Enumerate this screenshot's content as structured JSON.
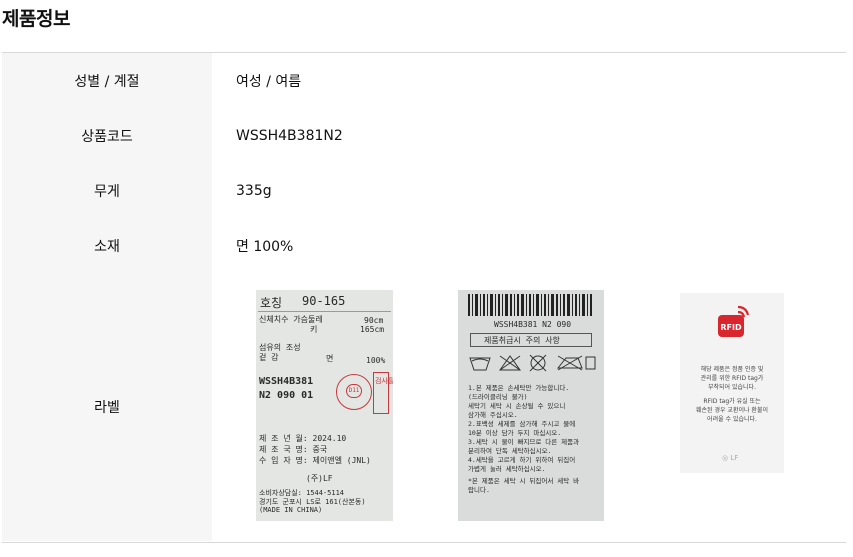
{
  "section": {
    "title": "제품정보"
  },
  "rows": [
    {
      "label": "성별 / 계절",
      "value": "여성 / 여름"
    },
    {
      "label": "상품코드",
      "value": "WSSH4B381N2"
    },
    {
      "label": "무게",
      "value": "335g"
    },
    {
      "label": "소재",
      "value": "면 100%"
    },
    {
      "label": "라벨"
    }
  ],
  "label_front": {
    "size_title": "호칭",
    "size_value": "90-165",
    "body_label": "신체치수 가슴둘레",
    "chest": "90cm",
    "height_label": "키",
    "height": "165cm",
    "fiber_label": "섬유의 조성",
    "shell_label": "겉 감",
    "material": "면",
    "percent": "100%",
    "code_line1": "WSSH4B381",
    "code_line2": "N2 090 01",
    "stamp_text": "D11",
    "inspect_text": "검사필",
    "made_date": "제 조 년 월: 2024.10",
    "made_country": "제 조 국 명: 중국",
    "importer": "수 입 자 명: 제이앤엘 (JNL)",
    "company": "(주)LF",
    "phone": "소비자상담실: 1544-5114",
    "address": "경기도 군포시 LS로 161(산본동)",
    "made_in": "(MADE IN CHINA)"
  },
  "label_back": {
    "code": "WSSH4B381 N2 090",
    "header": "제품취급시 주의 사항",
    "lines": [
      "1.본 제품은 손세탁만 가능합니다.",
      "(드라이클리닝 불가)",
      "세탁기 세탁 시 손상될 수 있으니",
      "삼가해 주십시오.",
      "2.표백성 세제를 삼가해 주시고 물에",
      "10분 이상 담가 두지 마십시오.",
      "3.세탁 시 물이 빠지므로 다른 제품과",
      "분리하여 단독 세탁하십시오.",
      "4.세탁을 고르게 하기 위하여 뒤집어",
      "가볍게 눌러 세탁하십시오.",
      "*본 제품은 세탁 시 뒤집어서 세탁 바",
      "랍니다."
    ]
  },
  "rfid_tag": {
    "icon_text": "RFID",
    "line1": "해당 제품은 정품 인증 및",
    "line2": "관리를 위한 RFID tag가",
    "line3": "부착되어 있습니다.",
    "line4": "RFID tag가 유실 또는",
    "line5": "훼손된 경우 교환이나 환불이",
    "line6": "어려울 수 있습니다.",
    "logo": "LF",
    "accent_color": "#d9262e"
  }
}
